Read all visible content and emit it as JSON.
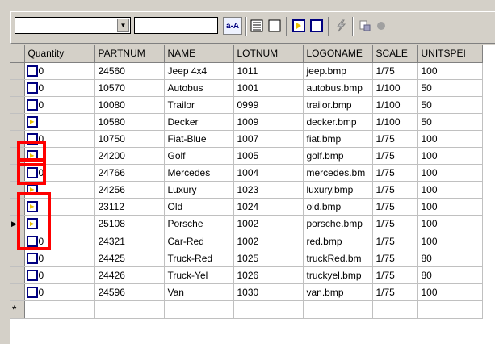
{
  "toolbar": {
    "combo1_value": "",
    "combo2_value": "",
    "case_button_label": "a-A",
    "icons": [
      "list-icon",
      "blank-box-icon",
      "checked-item-icon",
      "blank-box-icon",
      "lightning-icon",
      "wizard-icon",
      "status-dot-icon"
    ]
  },
  "grid": {
    "columns": [
      "Quantity",
      "PARTNUM",
      "NAME",
      "LOTNUM",
      "LOGONAME",
      "SCALE",
      "UNITSPEI"
    ],
    "rows": [
      {
        "checked": false,
        "qty": "0",
        "partnum": "24560",
        "name": "Jeep 4x4",
        "lotnum": "1011",
        "logoname": "jeep.bmp",
        "scale": "1/75",
        "unitspec": "100"
      },
      {
        "checked": false,
        "qty": "0",
        "partnum": "10570",
        "name": "Autobus",
        "lotnum": "1001",
        "logoname": "autobus.bmp",
        "scale": "1/100",
        "unitspec": "50"
      },
      {
        "checked": false,
        "qty": "0",
        "partnum": "10080",
        "name": "Trailor",
        "lotnum": "0999",
        "logoname": "trailor.bmp",
        "scale": "1/100",
        "unitspec": "50"
      },
      {
        "checked": true,
        "qty": "",
        "partnum": "10580",
        "name": "Decker",
        "lotnum": "1009",
        "logoname": "decker.bmp",
        "scale": "1/100",
        "unitspec": "50"
      },
      {
        "checked": false,
        "qty": "0",
        "partnum": "10750",
        "name": "Fiat-Blue",
        "lotnum": "1007",
        "logoname": "fiat.bmp",
        "scale": "1/75",
        "unitspec": "100"
      },
      {
        "checked": true,
        "qty": "",
        "partnum": "24200",
        "name": "Golf",
        "lotnum": "1005",
        "logoname": "golf.bmp",
        "scale": "1/75",
        "unitspec": "100"
      },
      {
        "checked": false,
        "qty": "0",
        "partnum": "24766",
        "name": "Mercedes",
        "lotnum": "1004",
        "logoname": "mercedes.bm",
        "scale": "1/75",
        "unitspec": "100"
      },
      {
        "checked": true,
        "qty": "",
        "partnum": "24256",
        "name": "Luxury",
        "lotnum": "1023",
        "logoname": "luxury.bmp",
        "scale": "1/75",
        "unitspec": "100"
      },
      {
        "checked": true,
        "qty": "",
        "partnum": "23112",
        "name": "Old",
        "lotnum": "1024",
        "logoname": "old.bmp",
        "scale": "1/75",
        "unitspec": "100"
      },
      {
        "checked": true,
        "qty": "",
        "partnum": "25108",
        "name": "Porsche",
        "lotnum": "1002",
        "logoname": "porsche.bmp",
        "scale": "1/75",
        "unitspec": "100",
        "current": true
      },
      {
        "checked": false,
        "qty": "0",
        "partnum": "24321",
        "name": "Car-Red",
        "lotnum": "1002",
        "logoname": "red.bmp",
        "scale": "1/75",
        "unitspec": "100"
      },
      {
        "checked": false,
        "qty": "0",
        "partnum": "24425",
        "name": "Truck-Red",
        "lotnum": "1025",
        "logoname": "truckRed.bm",
        "scale": "1/75",
        "unitspec": "80"
      },
      {
        "checked": false,
        "qty": "0",
        "partnum": "24426",
        "name": "Truck-Yel",
        "lotnum": "1026",
        "logoname": "truckyel.bmp",
        "scale": "1/75",
        "unitspec": "80"
      },
      {
        "checked": false,
        "qty": "0",
        "partnum": "24596",
        "name": "Van",
        "lotnum": "1030",
        "logoname": "van.bmp",
        "scale": "1/75",
        "unitspec": "100"
      }
    ],
    "new_row_marker": "*",
    "current_row_marker": "▶"
  },
  "colors": {
    "highlight": "#ff0000",
    "checkbox_border": "#00007f",
    "check_glyph": "#e8c000"
  }
}
